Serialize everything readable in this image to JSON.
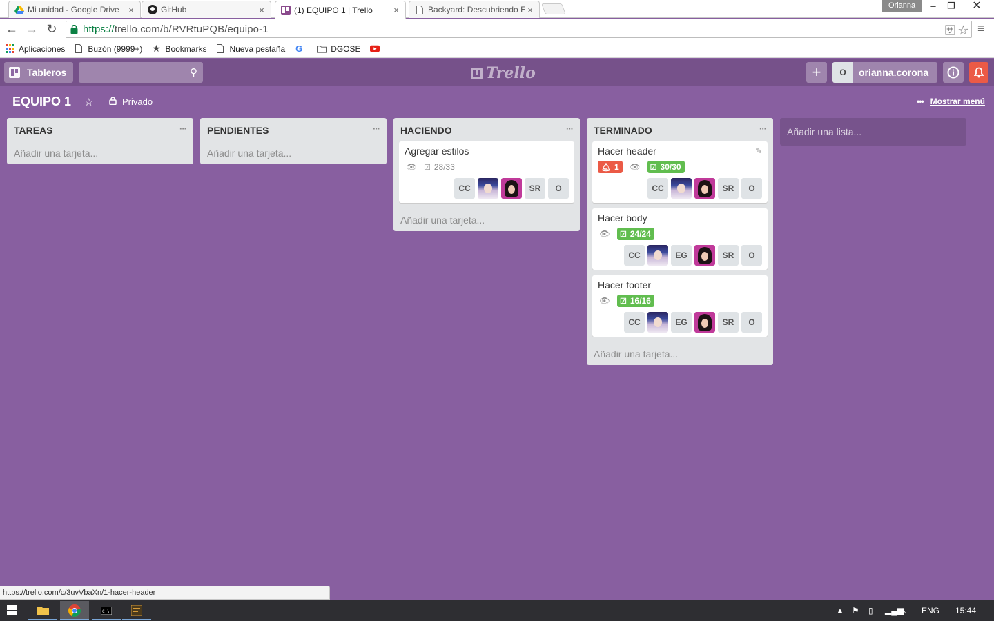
{
  "browser": {
    "tabs": [
      {
        "label": "Mi unidad - Google Drive",
        "icon": "google-drive-icon",
        "active": false
      },
      {
        "label": "GitHub",
        "icon": "github-icon",
        "active": false
      },
      {
        "label": "(1) EQUIPO 1 | Trello",
        "icon": "trello-icon",
        "active": true
      },
      {
        "label": "Backyard: Descubriendo E",
        "icon": "page-icon",
        "active": false
      }
    ],
    "profile": "Orianna",
    "url_scheme": "https://",
    "url_rest": "trello.com/b/RVRtuPQB/equipo-1",
    "bookmarks": [
      {
        "label": "Aplicaciones",
        "icon": "apps-grid-icon"
      },
      {
        "label": "Buzón (9999+)",
        "icon": "page-icon"
      },
      {
        "label": "Bookmarks",
        "icon": "star-icon"
      },
      {
        "label": "Nueva pestaña",
        "icon": "page-icon"
      },
      {
        "label": "",
        "icon": "google-icon"
      },
      {
        "label": "DGOSE",
        "icon": "folder-icon"
      },
      {
        "label": "",
        "icon": "youtube-icon"
      }
    ]
  },
  "header": {
    "boards_label": "Tableros",
    "logo_text": "Trello",
    "member_initial": "O",
    "member_name": "orianna.corona"
  },
  "board": {
    "title": "EQUIPO 1",
    "visibility": "Privado",
    "show_menu": "Mostrar menú",
    "add_list": "Añadir una lista..."
  },
  "lists": [
    {
      "title": "TAREAS",
      "add_card": "Añadir una tarjeta...",
      "cards": []
    },
    {
      "title": "PENDIENTES",
      "add_card": "Añadir una tarjeta...",
      "cards": []
    },
    {
      "title": "HACIENDO",
      "add_card": "Añadir una tarjeta...",
      "cards": [
        {
          "title": "Agregar estilos",
          "checklist": "28/33",
          "complete": false,
          "notifications": "",
          "members": [
            "CC",
            "photo-a",
            "photo-b",
            "SR",
            "O"
          ]
        }
      ]
    },
    {
      "title": "TERMINADO",
      "add_card": "Añadir una tarjeta...",
      "cards": [
        {
          "title": "Hacer header",
          "checklist": "30/30",
          "complete": true,
          "notifications": "1",
          "members": [
            "CC",
            "photo-a",
            "photo-b",
            "SR",
            "O"
          ]
        },
        {
          "title": "Hacer body",
          "checklist": "24/24",
          "complete": true,
          "notifications": "",
          "members": [
            "CC",
            "photo-a",
            "EG",
            "photo-b",
            "SR",
            "O"
          ]
        },
        {
          "title": "Hacer footer",
          "checklist": "16/16",
          "complete": true,
          "notifications": "",
          "members": [
            "CC",
            "photo-a",
            "EG",
            "photo-b",
            "SR",
            "O"
          ]
        }
      ]
    }
  ],
  "status_url": "https://trello.com/c/3uvVbaXn/1-hacer-header",
  "taskbar": {
    "language": "ENG",
    "time": "15:44"
  },
  "colors": {
    "board_bg": "#885fa0",
    "header_bg": "#76518a",
    "green": "#61bd4f",
    "red": "#eb5a46"
  }
}
